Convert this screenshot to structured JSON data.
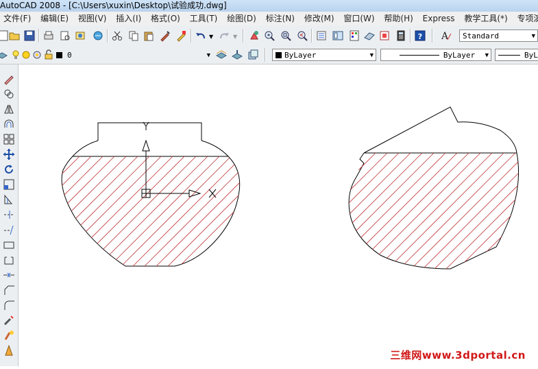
{
  "window": {
    "title": "AutoCAD 2008 - [C:\\Users\\xuxin\\Desktop\\试验成功.dwg]"
  },
  "menu": [
    "文件(F)",
    "编辑(E)",
    "视图(V)",
    "插入(I)",
    "格式(O)",
    "工具(T)",
    "绘图(D)",
    "标注(N)",
    "修改(M)",
    "窗口(W)",
    "帮助(H)",
    "Express",
    "教学工具(*)",
    "专项演示"
  ],
  "toolbar": {
    "text_style": "Standard"
  },
  "layers": {
    "current_layer": "0",
    "color": "ByLayer",
    "linetype": "ByLayer",
    "lineweight": "ByLa"
  },
  "drawing": {
    "ucs_x_label": "X",
    "ucs_y_label": "Y",
    "hatch_color": "#c0393b"
  },
  "watermark": "三维网www.3dportal.cn"
}
